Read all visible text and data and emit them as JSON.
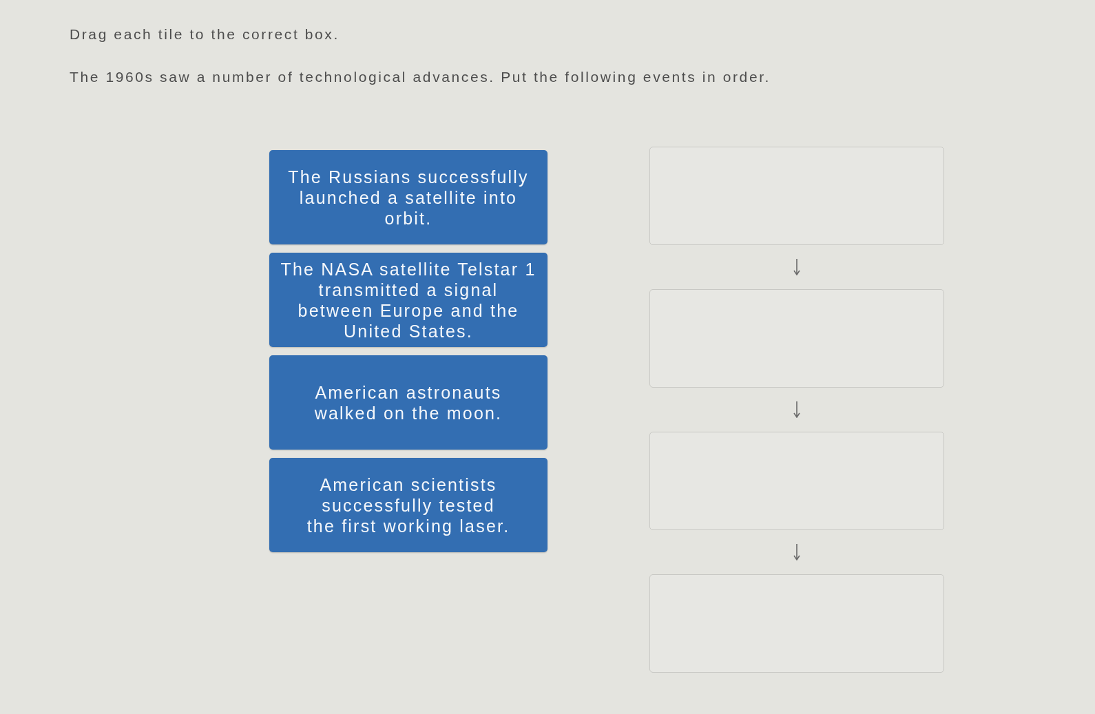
{
  "instructions": "Drag each tile to the correct box.",
  "question": "The 1960s saw a number of technological advances. Put the following events in order.",
  "tiles": [
    {
      "text": "The Russians successfully\nlaunched a satellite into\norbit."
    },
    {
      "text": "The NASA satellite Telstar 1\ntransmitted a signal\nbetween Europe and the\nUnited States."
    },
    {
      "text": "American astronauts\nwalked on the moon."
    },
    {
      "text": "American scientists\nsuccessfully tested\nthe first working laser."
    }
  ],
  "drop_boxes": [
    {
      "kind": "empty"
    },
    {
      "kind": "empty"
    },
    {
      "kind": "empty"
    },
    {
      "kind": "empty"
    }
  ]
}
